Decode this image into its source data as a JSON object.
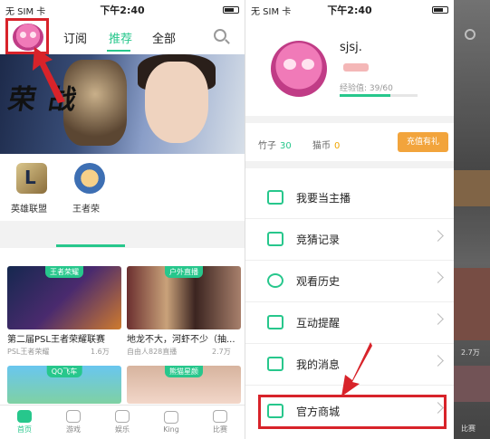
{
  "status_left": {
    "carrier": "无 SIM 卡",
    "time": "下午2:40"
  },
  "status_right": {
    "carrier": "无 SIM 卡",
    "time": "下午2:40"
  },
  "left": {
    "nav_tabs": [
      "订阅",
      "推荐",
      "全部"
    ],
    "active_tab": "推荐",
    "games": [
      "英雄联盟",
      "王者荣"
    ],
    "cards": [
      {
        "tag": "王者荣耀",
        "title": "第二届PSL王者荣耀联赛",
        "sub": "PSL王者荣耀",
        "views": "1.6万"
      },
      {
        "tag": "户外直播",
        "title": "地龙不大，河虾不少（抽...",
        "sub": "自由人828直播",
        "views": "2.7万"
      },
      {
        "tag": "QQ飞车",
        "title": "",
        "sub": "",
        "views": ""
      },
      {
        "tag": "熊猫星颜",
        "title": "",
        "sub": "",
        "views": ""
      }
    ],
    "tabbar": [
      "首页",
      "游戏",
      "娱乐",
      "King",
      "比赛"
    ],
    "colors": {
      "accent": "#27c78c",
      "highlight": "#d8232a"
    }
  },
  "right": {
    "username": "sjsj.",
    "exp": "经验值: 39/60",
    "exp_progress": 0.65,
    "bamboo_label": "竹子",
    "bamboo": "30",
    "catcoin_label": "猫币",
    "catcoin": "0",
    "recharge": "充值有礼",
    "menu": [
      "我要当主播",
      "竞猜记录",
      "观看历史",
      "互动提醒",
      "我的消息",
      "官方商城"
    ],
    "side_views": "2.7万",
    "side_tab": "比赛"
  }
}
